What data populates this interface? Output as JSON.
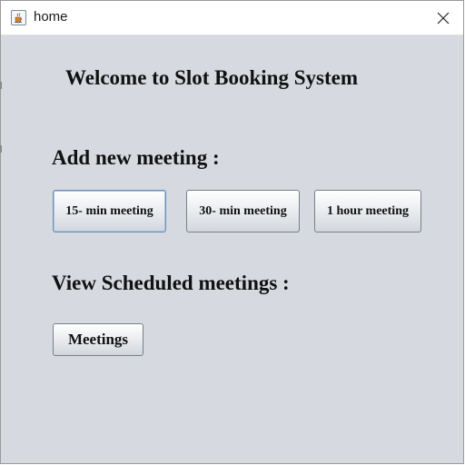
{
  "window": {
    "title": "home",
    "app_icon": "java-cup-icon",
    "close_icon": "close-x-icon"
  },
  "main": {
    "welcome_heading": "Welcome to Slot Booking System",
    "add_section_label": "Add new meeting :",
    "add_buttons": [
      {
        "label": "15- min meeting",
        "focused": true
      },
      {
        "label": "30- min meeting",
        "focused": false
      },
      {
        "label": "1 hour meeting",
        "focused": false
      }
    ],
    "view_section_label": "View Scheduled meetings :",
    "meetings_button": "Meetings"
  },
  "colors": {
    "window_bg": "#d6d9e0",
    "titlebar_bg": "#ffffff",
    "focus_border": "#6d8fb8"
  }
}
